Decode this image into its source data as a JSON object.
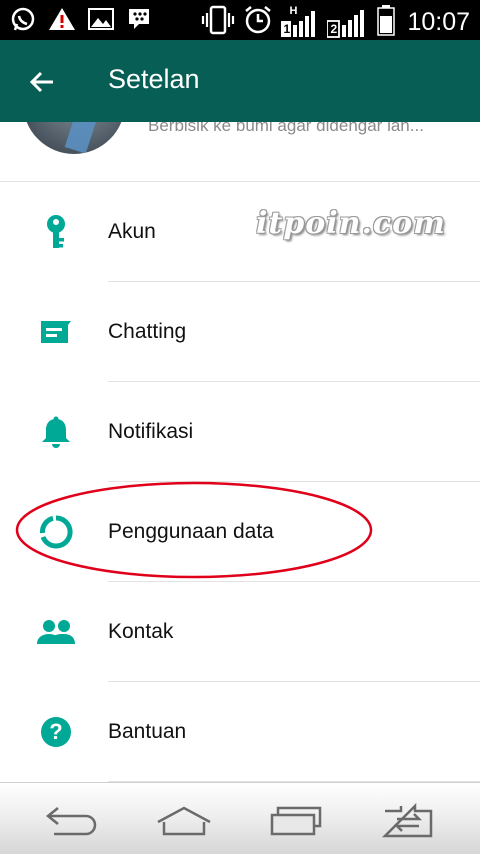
{
  "status_bar": {
    "time": "10:07",
    "left_icons": [
      "whatsapp-icon",
      "warning-icon",
      "gallery-icon",
      "bbm-icon"
    ],
    "right_icons": [
      "vibrate-icon",
      "alarm-icon",
      "signal-sim1-icon",
      "signal-sim2-icon",
      "battery-icon"
    ],
    "sim1_label": "1",
    "sim2_label": "2",
    "network_label": "H"
  },
  "app_bar": {
    "title": "Setelan",
    "color": "#075e54"
  },
  "profile": {
    "status": "Berbisik ke bumi agar didengar lan..."
  },
  "watermark": "itpoin.com",
  "settings": [
    {
      "label": "Akun",
      "icon": "key-icon"
    },
    {
      "label": "Chatting",
      "icon": "chat-icon"
    },
    {
      "label": "Notifikasi",
      "icon": "bell-icon"
    },
    {
      "label": "Penggunaan data",
      "icon": "data-usage-icon"
    },
    {
      "label": "Kontak",
      "icon": "contacts-icon"
    },
    {
      "label": "Bantuan",
      "icon": "help-icon"
    }
  ],
  "accent_color": "#00a896",
  "highlight_color": "#e0001a",
  "nav_bar": [
    "back-icon",
    "home-icon",
    "recent-apps-icon",
    "switch-icon"
  ]
}
